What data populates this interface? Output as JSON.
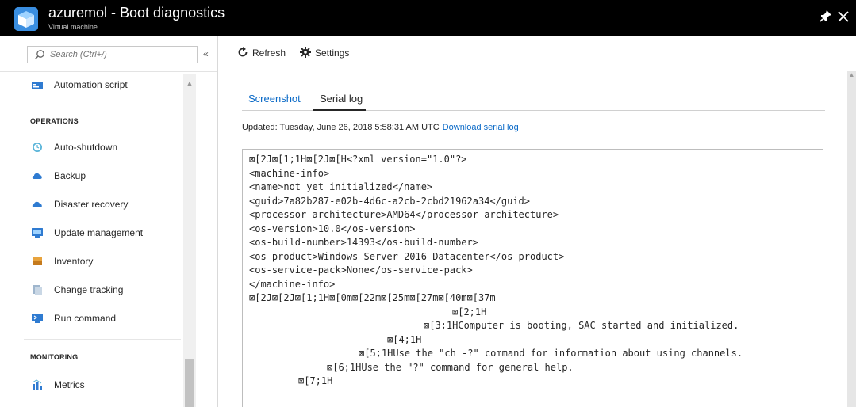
{
  "header": {
    "title": "azuremol - Boot diagnostics",
    "subtitle": "Virtual machine",
    "pin_icon": "pin-icon",
    "close_icon": "close-icon"
  },
  "sidebar": {
    "search_placeholder": "Search (Ctrl+/)",
    "collapse_label": "«",
    "items_top": [
      {
        "label": "Automation script",
        "icon": "automation-script-icon",
        "color": "#2f7bd1"
      }
    ],
    "operations_title": "OPERATIONS",
    "operations": [
      {
        "label": "Auto-shutdown",
        "icon": "clock-icon",
        "color": "#59b4d9"
      },
      {
        "label": "Backup",
        "icon": "cloud-backup-icon",
        "color": "#2f7bd1"
      },
      {
        "label": "Disaster recovery",
        "icon": "cloud-recovery-icon",
        "color": "#2f7bd1"
      },
      {
        "label": "Update management",
        "icon": "update-management-icon",
        "color": "#2f7bd1"
      },
      {
        "label": "Inventory",
        "icon": "inventory-icon",
        "color": "#e8a33d"
      },
      {
        "label": "Change tracking",
        "icon": "change-tracking-icon",
        "color": "#9fb6cd"
      },
      {
        "label": "Run command",
        "icon": "run-command-icon",
        "color": "#2f7bd1"
      }
    ],
    "monitoring_title": "MONITORING",
    "monitoring": [
      {
        "label": "Metrics",
        "icon": "metrics-icon",
        "color": "#2f7bd1"
      }
    ]
  },
  "toolbar": {
    "refresh_label": "Refresh",
    "settings_label": "Settings"
  },
  "tabs": {
    "screenshot": "Screenshot",
    "serial_log": "Serial log",
    "active": "Serial log"
  },
  "status": {
    "updated": "Updated: Tuesday, June 26, 2018 5:58:31 AM UTC",
    "download_link": "Download serial log"
  },
  "serial_log": {
    "lines": [
      {
        "indent": 0,
        "text": "⊠[2J⊠[1;1H⊠[2J⊠[H<?xml version=\"1.0\"?>"
      },
      {
        "indent": 0,
        "text": "<machine-info>"
      },
      {
        "indent": 0,
        "text": "<name>not yet initialized</name>"
      },
      {
        "indent": 0,
        "text": "<guid>7a82b287-e02b-4d6c-a2cb-2cbd21962a34</guid>"
      },
      {
        "indent": 0,
        "text": "<processor-architecture>AMD64</processor-architecture>"
      },
      {
        "indent": 0,
        "text": "<os-version>10.0</os-version>"
      },
      {
        "indent": 0,
        "text": "<os-build-number>14393</os-build-number>"
      },
      {
        "indent": 0,
        "text": "<os-product>Windows Server 2016 Datacenter</os-product>"
      },
      {
        "indent": 0,
        "text": "<os-service-pack>None</os-service-pack>"
      },
      {
        "indent": 0,
        "text": "</machine-info>"
      },
      {
        "indent": 0,
        "text": "⊠[2J⊠[2J⊠[1;1H⊠[0m⊠[22m⊠[25m⊠[27m⊠[40m⊠[37m"
      },
      {
        "indent": 256,
        "text": "⊠[2;1H"
      },
      {
        "indent": 220,
        "text": "⊠[3;1HComputer is booting, SAC started and initialized."
      },
      {
        "indent": 174,
        "text": "⊠[4;1H"
      },
      {
        "indent": 138,
        "text": "⊠[5;1HUse the \"ch -?\" command for information about using channels."
      },
      {
        "indent": 98,
        "text": "⊠[6;1HUse the \"?\" command for general help."
      },
      {
        "indent": 62,
        "text": "⊠[7;1H"
      }
    ]
  }
}
